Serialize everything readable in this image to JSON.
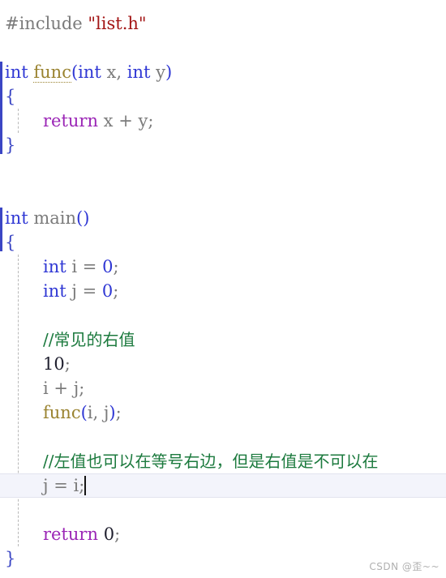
{
  "editor": {
    "language": "C++",
    "watermark": "CSDN @歪~~",
    "cursor_line_number": 19,
    "colors": {
      "background": "#ffffff",
      "plain_text": "#7b7b7b",
      "keyword": "#2f37d4",
      "string": "#a31515",
      "comment": "#1c7a3e",
      "return_keyword": "#9b26b6",
      "function_name": "#9a8330",
      "brace": "#3b46c4",
      "fold_bar": "#3b46c4",
      "indent_guide": "#b9b9b9",
      "current_line_highlight": "#f3f4fb",
      "caret": "#151515",
      "watermark": "#b0b0b0"
    }
  },
  "code": {
    "lines": [
      {
        "id": 1,
        "indent": 0,
        "fold_bar": false,
        "current": false,
        "tokens": [
          {
            "text": "#include ",
            "kind": "plain"
          },
          {
            "text": "\"list.h\"",
            "kind": "string"
          }
        ]
      },
      {
        "id": 2,
        "indent": 0,
        "fold_bar": false,
        "current": false,
        "tokens": []
      },
      {
        "id": 3,
        "indent": 0,
        "fold_bar": true,
        "current": false,
        "tokens": [
          {
            "text": "int",
            "kind": "keyword"
          },
          {
            "text": " ",
            "kind": "plain"
          },
          {
            "text": "func",
            "kind": "function-declaration"
          },
          {
            "text": "(",
            "kind": "punct"
          },
          {
            "text": "int",
            "kind": "keyword"
          },
          {
            "text": " x",
            "kind": "plain"
          },
          {
            "text": ", ",
            "kind": "plain"
          },
          {
            "text": "int",
            "kind": "keyword"
          },
          {
            "text": " y",
            "kind": "plain"
          },
          {
            "text": ")",
            "kind": "punct"
          }
        ]
      },
      {
        "id": 4,
        "indent": 0,
        "fold_bar": true,
        "current": false,
        "tokens": [
          {
            "text": "{",
            "kind": "brace"
          }
        ]
      },
      {
        "id": 5,
        "indent": 1,
        "fold_bar": true,
        "current": false,
        "tokens": [
          {
            "text": "return",
            "kind": "return"
          },
          {
            "text": " x ",
            "kind": "plain"
          },
          {
            "text": "+",
            "kind": "op"
          },
          {
            "text": " y;",
            "kind": "plain"
          }
        ]
      },
      {
        "id": 6,
        "indent": 0,
        "fold_bar": true,
        "current": false,
        "tokens": [
          {
            "text": "}",
            "kind": "brace"
          }
        ]
      },
      {
        "id": 7,
        "indent": 0,
        "fold_bar": false,
        "current": false,
        "tokens": []
      },
      {
        "id": 8,
        "indent": 0,
        "fold_bar": false,
        "current": false,
        "tokens": []
      },
      {
        "id": 9,
        "indent": 0,
        "fold_bar": true,
        "current": false,
        "tokens": [
          {
            "text": "int",
            "kind": "keyword"
          },
          {
            "text": " main",
            "kind": "plain"
          },
          {
            "text": "()",
            "kind": "punct"
          }
        ]
      },
      {
        "id": 10,
        "indent": 0,
        "fold_bar": true,
        "current": false,
        "tokens": [
          {
            "text": "{",
            "kind": "brace"
          }
        ]
      },
      {
        "id": 11,
        "indent": 1,
        "fold_bar": false,
        "current": false,
        "tokens": [
          {
            "text": "int",
            "kind": "keyword"
          },
          {
            "text": " i ",
            "kind": "plain"
          },
          {
            "text": "=",
            "kind": "op"
          },
          {
            "text": " ",
            "kind": "plain"
          },
          {
            "text": "0",
            "kind": "number"
          },
          {
            "text": ";",
            "kind": "plain"
          }
        ]
      },
      {
        "id": 12,
        "indent": 1,
        "fold_bar": false,
        "current": false,
        "tokens": [
          {
            "text": "int",
            "kind": "keyword"
          },
          {
            "text": " j ",
            "kind": "plain"
          },
          {
            "text": "=",
            "kind": "op"
          },
          {
            "text": " ",
            "kind": "plain"
          },
          {
            "text": "0",
            "kind": "number"
          },
          {
            "text": ";",
            "kind": "plain"
          }
        ]
      },
      {
        "id": 13,
        "indent": 1,
        "fold_bar": false,
        "current": false,
        "tokens": []
      },
      {
        "id": 14,
        "indent": 1,
        "fold_bar": false,
        "current": false,
        "tokens": [
          {
            "text": "//常见的右值",
            "kind": "comment"
          }
        ]
      },
      {
        "id": 15,
        "indent": 1,
        "fold_bar": false,
        "current": false,
        "tokens": [
          {
            "text": "10",
            "kind": "number-dark"
          },
          {
            "text": ";",
            "kind": "plain"
          }
        ]
      },
      {
        "id": 16,
        "indent": 1,
        "fold_bar": false,
        "current": false,
        "tokens": [
          {
            "text": "i ",
            "kind": "plain"
          },
          {
            "text": "+",
            "kind": "op"
          },
          {
            "text": " j;",
            "kind": "plain"
          }
        ]
      },
      {
        "id": 17,
        "indent": 1,
        "fold_bar": false,
        "current": false,
        "tokens": [
          {
            "text": "func",
            "kind": "function-call"
          },
          {
            "text": "(",
            "kind": "punct"
          },
          {
            "text": "i, ",
            "kind": "plain"
          },
          {
            "text": "j",
            "kind": "plain"
          },
          {
            "text": ")",
            "kind": "punct"
          },
          {
            "text": ";",
            "kind": "plain"
          }
        ]
      },
      {
        "id": 18,
        "indent": 1,
        "fold_bar": false,
        "current": false,
        "tokens": []
      },
      {
        "id": 19,
        "indent": 1,
        "fold_bar": false,
        "current": false,
        "clipped_right": true,
        "tokens": [
          {
            "text": "//左值也可以在等号右边，但是右值是不可以在",
            "kind": "comment"
          }
        ]
      },
      {
        "id": 20,
        "indent": 1,
        "fold_bar": false,
        "current": true,
        "caret_after": true,
        "tokens": [
          {
            "text": "j ",
            "kind": "plain"
          },
          {
            "text": "=",
            "kind": "op"
          },
          {
            "text": " i",
            "kind": "plain"
          },
          {
            "text": ";",
            "kind": "plain"
          }
        ]
      },
      {
        "id": 21,
        "indent": 1,
        "fold_bar": false,
        "current": false,
        "tokens": []
      },
      {
        "id": 22,
        "indent": 1,
        "fold_bar": false,
        "current": false,
        "tokens": [
          {
            "text": "return",
            "kind": "return"
          },
          {
            "text": " ",
            "kind": "plain"
          },
          {
            "text": "0",
            "kind": "number-dark"
          },
          {
            "text": ";",
            "kind": "plain"
          }
        ]
      },
      {
        "id": 23,
        "indent": 0,
        "fold_bar": false,
        "current": false,
        "tokens": [
          {
            "text": "}",
            "kind": "brace"
          }
        ]
      }
    ]
  }
}
